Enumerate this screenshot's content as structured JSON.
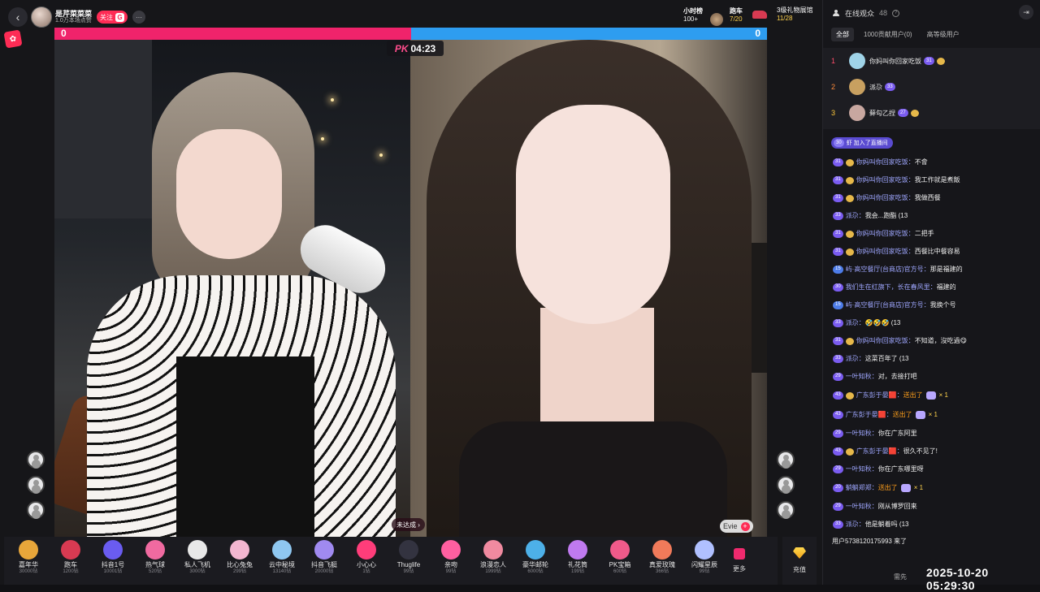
{
  "header": {
    "host_name": "是芹菜菜菜",
    "host_sub": "1.0万本场点赞",
    "follow_label": "关注",
    "follow_badge": "G",
    "more_label": "···",
    "back_label": "‹",
    "rank_hour_title": "小时榜",
    "rank_hour_value": "100+",
    "car_title": "跑车",
    "car_value": "7/20",
    "shop_title": "3级礼物展馆",
    "shop_value": "11/28"
  },
  "pk": {
    "left_score": "0",
    "right_score": "0",
    "label": "PK",
    "timer": "04:23",
    "left_color": "#f0236b",
    "right_color": "#2e9df0"
  },
  "video": {
    "left_status": "未达成",
    "right_name": "Evie"
  },
  "gifts": [
    {
      "name": "嘉年华",
      "price": "30000钻",
      "color": "#e8a63a"
    },
    {
      "name": "跑车",
      "price": "1200钻",
      "color": "#d83a52"
    },
    {
      "name": "抖音1号",
      "price": "10001钻",
      "color": "#6a5cf0"
    },
    {
      "name": "热气球",
      "price": "520钻",
      "color": "#f06aa0"
    },
    {
      "name": "私人飞机",
      "price": "3000钻",
      "color": "#e8e8e8"
    },
    {
      "name": "比心兔兔",
      "price": "299钻",
      "color": "#f3b6d0"
    },
    {
      "name": "云中秘境",
      "price": "13140钻",
      "color": "#8fc7f0"
    },
    {
      "name": "抖音飞艇",
      "price": "20000钻",
      "color": "#a08af0"
    },
    {
      "name": "小心心",
      "price": "1钻",
      "color": "#ff3d7a"
    },
    {
      "name": "Thuglife",
      "price": "99钻",
      "color": "#333340"
    },
    {
      "name": "亲吻",
      "price": "99钻",
      "color": "#ff5fa0"
    },
    {
      "name": "浪漫恋人",
      "price": "1999钻",
      "color": "#f08aa0"
    },
    {
      "name": "豪华邮轮",
      "price": "6000钻",
      "color": "#4db0e8"
    },
    {
      "name": "礼花筒",
      "price": "199钻",
      "color": "#c07af0"
    },
    {
      "name": "PK宝箱",
      "price": "600钻",
      "color": "#f05a8a"
    },
    {
      "name": "真爱玫瑰",
      "price": "366钻",
      "color": "#f07a5a"
    },
    {
      "name": "闪耀星辰",
      "price": "99钻",
      "color": "#b0c0ff"
    }
  ],
  "gift_more_label": "更多",
  "recharge_label": "充值",
  "audience": {
    "title": "在线观众",
    "count": "48",
    "help": "?",
    "collapse": "⇥",
    "tabs": [
      "全部",
      "1000贡献用户(0)",
      "高等级用户"
    ],
    "ranks": [
      {
        "no": "1",
        "name": "你妈叫你回家吃饭",
        "level": "31",
        "no_color": "#ff4d6a",
        "av_color": "#9fd3e8"
      },
      {
        "no": "2",
        "name": "派尕",
        "level": "33",
        "no_color": "#ff8c3a",
        "av_color": "#c8a060"
      },
      {
        "no": "3",
        "name": "藓勾乙捏",
        "level": "27",
        "no_color": "#ffc83a",
        "av_color": "#c8a7a0"
      }
    ]
  },
  "join_notice": {
    "level": "30",
    "text": "虾 加入了直播间"
  },
  "chat": [
    {
      "level": "31",
      "heart": true,
      "user": "你妈叫你回家吃饭：",
      "text": "不會"
    },
    {
      "level": "31",
      "heart": true,
      "user": "你妈叫你回家吃饭：",
      "text": "我工作就是煮飯"
    },
    {
      "level": "31",
      "heart": true,
      "user": "你妈叫你回家吃饭：",
      "text": "我做西餐"
    },
    {
      "level": "33",
      "heart": false,
      "user": "派尕：",
      "text": "我会...跑酯  (13"
    },
    {
      "level": "31",
      "heart": true,
      "user": "你妈叫你回家吃饭：",
      "text": "二把手"
    },
    {
      "level": "31",
      "heart": true,
      "user": "你妈叫你回家吃饭：",
      "text": "西餐比中餐容易"
    },
    {
      "level": "15",
      "heart": false,
      "user": "屿·高空餐厅(台商店)官方号：",
      "text": "那是福建的"
    },
    {
      "level": "30",
      "heart": false,
      "user": "我们生在红旗下，长在春风里：",
      "text": "福建的"
    },
    {
      "level": "15",
      "heart": false,
      "user": "屿·高空餐厅(台商店)官方号：",
      "text": "我换个号"
    },
    {
      "level": "33",
      "heart": false,
      "user": "派尕：",
      "text": "🤣🤣🤣  (13"
    },
    {
      "level": "31",
      "heart": true,
      "user": "你妈叫你回家吃饭：",
      "text": "不知道，沒吃過😋"
    },
    {
      "level": "33",
      "heart": false,
      "user": "派尕：",
      "text": "这菜百年了  (13"
    },
    {
      "level": "29",
      "heart": false,
      "user": "一叶知秋：",
      "text": "对，去接打吧"
    },
    {
      "level": "43",
      "heart": true,
      "user": "广东彭于晏🟥：",
      "gift": "送出了",
      "count": "× 1"
    },
    {
      "level": "43",
      "heart": false,
      "user": "广东彭于晏🟥：",
      "gift": "送出了",
      "count": "× 1"
    },
    {
      "level": "29",
      "heart": false,
      "user": "一叶知秋：",
      "text": "你在广东阿里"
    },
    {
      "level": "43",
      "heart": true,
      "user": "广东彭于晏🟥：",
      "text": "很久不见了!"
    },
    {
      "level": "29",
      "heart": false,
      "user": "一叶知秋：",
      "text": "你在广东哪里呀"
    },
    {
      "level": "20",
      "heart": false,
      "user": "躺躺郑郑：",
      "gift": "送出了",
      "count": "× 1"
    },
    {
      "level": "29",
      "heart": false,
      "user": "一叶知秋：",
      "text": "刚从博罗回来"
    },
    {
      "level": "33",
      "heart": false,
      "user": "派尕：",
      "text": "他是躺着吗  (13"
    }
  ],
  "user_entered": "用户5738120175993 来了",
  "bottom_hint": "需先",
  "timestamp": "2025-10-20 05:29:30"
}
